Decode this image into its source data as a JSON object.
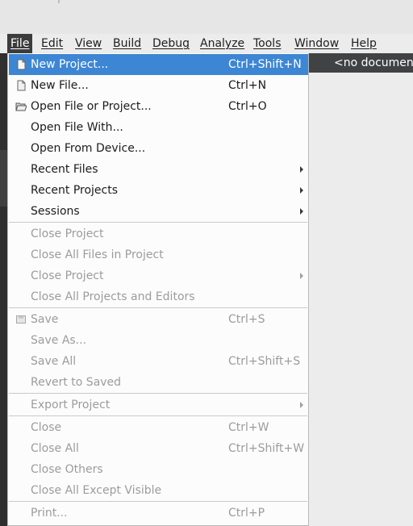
{
  "menubar": [
    {
      "label": "File",
      "active": true
    },
    {
      "label": "Edit"
    },
    {
      "label": "View"
    },
    {
      "label": "Build"
    },
    {
      "label": "Debug"
    },
    {
      "label": "Analyze"
    },
    {
      "label": "Tools"
    },
    {
      "label": "Window"
    },
    {
      "label": "Help"
    }
  ],
  "editor": {
    "document_label": "<no document>"
  },
  "file_menu": {
    "items": [
      {
        "label": "New Project...",
        "shortcut": "Ctrl+Shift+N",
        "icon": "new-project-icon",
        "highlighted": true
      },
      {
        "label": "New File...",
        "shortcut": "Ctrl+N",
        "icon": "new-file-icon"
      },
      {
        "label": "Open File or Project...",
        "shortcut": "Ctrl+O",
        "icon": "folder-open-icon"
      },
      {
        "label": "Open File With...",
        "shortcut": ""
      },
      {
        "label": "Open From Device...",
        "shortcut": ""
      },
      {
        "label": "Recent Files",
        "submenu": true
      },
      {
        "label": "Recent Projects",
        "submenu": true
      },
      {
        "label": "Sessions",
        "submenu": true
      },
      {
        "label": "Close Project",
        "disabled": true
      },
      {
        "label": "Close All Files in Project",
        "disabled": true
      },
      {
        "label": "Close Project",
        "disabled": true,
        "submenu": true
      },
      {
        "label": "Close All Projects and Editors",
        "disabled": true
      },
      {
        "label": "Save",
        "shortcut": "Ctrl+S",
        "disabled": true,
        "icon": "save-icon"
      },
      {
        "label": "Save As...",
        "disabled": true
      },
      {
        "label": "Save All",
        "shortcut": "Ctrl+Shift+S",
        "disabled": true
      },
      {
        "label": "Revert to Saved",
        "disabled": true
      },
      {
        "label": "Export Project",
        "disabled": true,
        "submenu": true
      },
      {
        "label": "Close",
        "shortcut": "Ctrl+W",
        "disabled": true
      },
      {
        "label": "Close All",
        "shortcut": "Ctrl+Shift+W",
        "disabled": true
      },
      {
        "label": "Close Others",
        "disabled": true
      },
      {
        "label": "Close All Except Visible",
        "disabled": true
      },
      {
        "label": "Print...",
        "shortcut": "Ctrl+P",
        "disabled": true
      }
    ]
  },
  "colors": {
    "highlight": "#3d86d4",
    "menubar_active": "#3c3c3c",
    "doc_bar": "#404244"
  }
}
